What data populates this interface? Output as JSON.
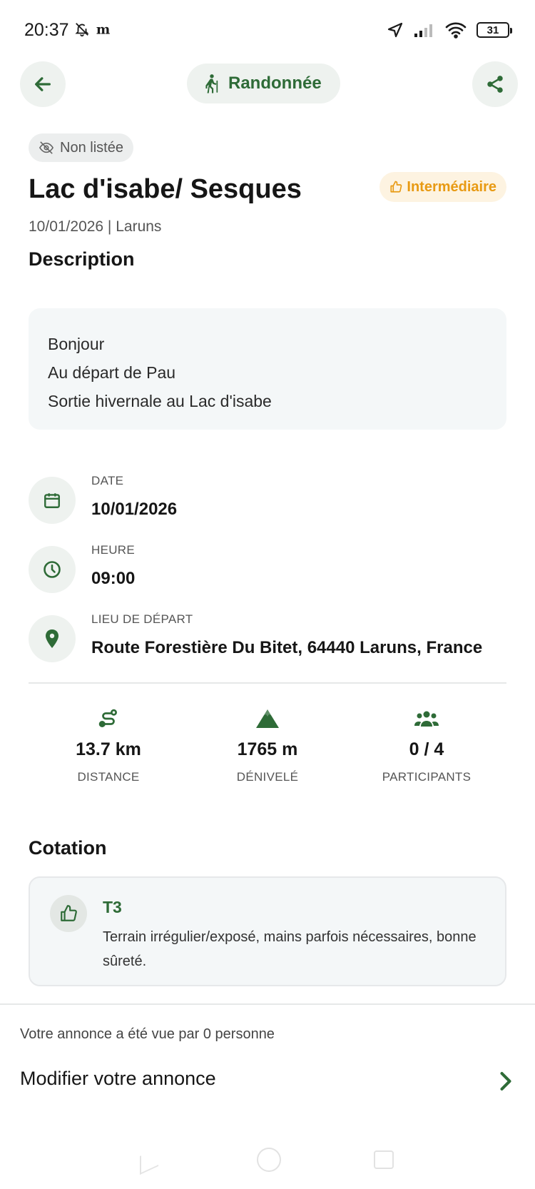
{
  "status_bar": {
    "time": "20:37",
    "battery": "31"
  },
  "header": {
    "category_label": "Randonnée"
  },
  "listing": {
    "visibility": "Non listée",
    "title": "Lac d'isabe/ Sesques",
    "level": "Intermédiaire",
    "subtitle": "10/01/2026 | Laruns"
  },
  "description": {
    "heading": "Description",
    "lines": [
      "Bonjour",
      "Au départ de Pau",
      "Sortie hivernale au Lac d'isabe"
    ]
  },
  "details": [
    {
      "label": "DATE",
      "value": "10/01/2026",
      "icon": "calendar-icon"
    },
    {
      "label": "HEURE",
      "value": "09:00",
      "icon": "clock-icon"
    },
    {
      "label": "LIEU DE DÉPART",
      "value": "Route Forestière Du Bitet, 64440 Laruns, France",
      "icon": "location-pin-icon"
    }
  ],
  "stats": [
    {
      "value": "13.7 km",
      "label": "DISTANCE",
      "icon": "route-icon"
    },
    {
      "value": "1765 m",
      "label": "DÉNIVELÉ",
      "icon": "mountain-icon"
    },
    {
      "value": "0 / 4",
      "label": "PARTICIPANTS",
      "icon": "group-icon"
    }
  ],
  "cotation": {
    "heading": "Cotation",
    "code": "T3",
    "text": "Terrain irrégulier/exposé, mains parfois nécessaires, bonne sûreté."
  },
  "footer": {
    "views": "Votre annonce a été vue par 0 personne",
    "edit_label": "Modifier votre annonce"
  },
  "colors": {
    "accent_green": "#2e6b37",
    "level_orange": "#e89a13"
  }
}
